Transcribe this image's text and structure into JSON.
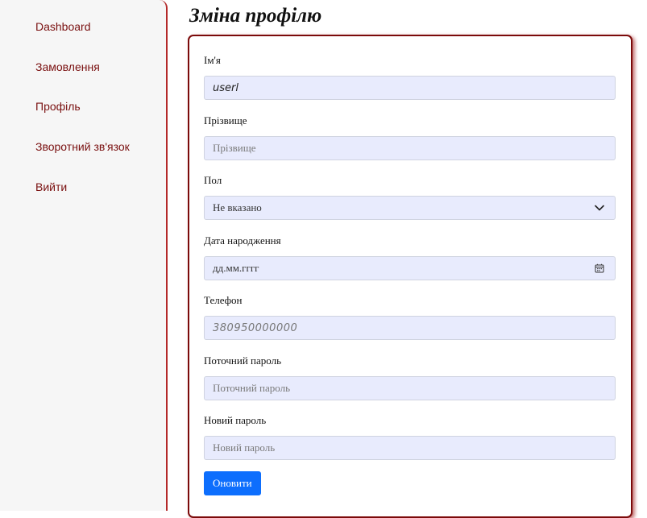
{
  "sidebar": {
    "items": [
      {
        "label": "Dashboard"
      },
      {
        "label": "Замовлення"
      },
      {
        "label": "Профіль"
      },
      {
        "label": "Зворотний зв'язок"
      },
      {
        "label": "Вийти"
      }
    ]
  },
  "page": {
    "title": "Зміна профілю"
  },
  "form": {
    "name": {
      "label": "Ім'я",
      "value": "userl"
    },
    "surname": {
      "label": "Прізвище",
      "placeholder": "Прізвище"
    },
    "gender": {
      "label": "Пол",
      "selected": "Не вказано"
    },
    "birthdate": {
      "label": "Дата народження",
      "placeholder": "дд.мм.гггг"
    },
    "phone": {
      "label": "Телефон",
      "placeholder": "380950000000"
    },
    "current_password": {
      "label": "Поточний пароль",
      "placeholder": "Поточний пароль"
    },
    "new_password": {
      "label": "Новий пароль",
      "placeholder": "Новий пароль"
    },
    "submit_label": "Оновити"
  },
  "colors": {
    "sidebar_link": "#7a1010",
    "sidebar_border": "#b42a2a",
    "card_border": "#7b0a0a",
    "input_bg": "#e8ebfd",
    "button_bg": "#0d6efd"
  },
  "icons": {
    "select": "chevron-down-icon",
    "date": "calendar-icon"
  }
}
